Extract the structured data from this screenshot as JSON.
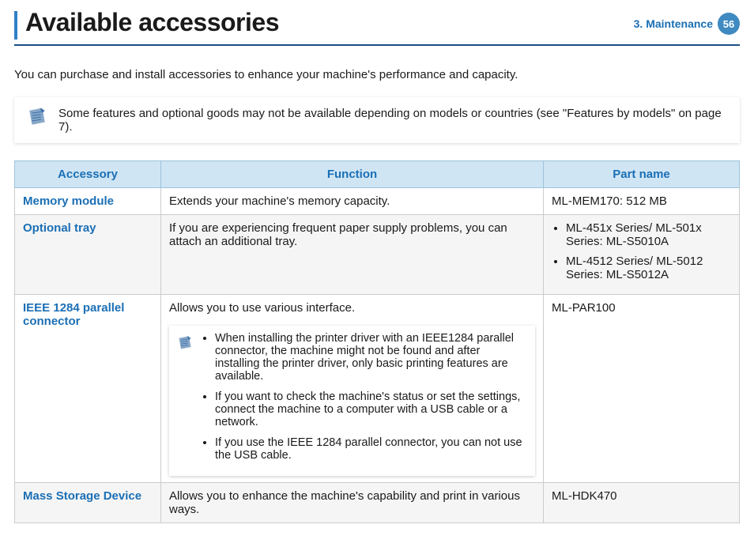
{
  "header": {
    "title": "Available accessories",
    "chapter": "3.  Maintenance",
    "page_number": "56"
  },
  "intro": "You can purchase and install accessories to enhance your machine's performance and capacity.",
  "top_note": "Some features and optional goods may not be available depending on models or countries (see \"Features by models\" on page 7).",
  "columns": {
    "c1": "Accessory",
    "c2": "Function",
    "c3": "Part name"
  },
  "rows": {
    "r1": {
      "name": "Memory module",
      "func": "Extends your machine's memory capacity.",
      "part": "ML-MEM170: 512 MB"
    },
    "r2": {
      "name": "Optional tray",
      "func": "If you are experiencing frequent paper supply problems, you can attach an additional tray.",
      "parts": {
        "p1": "ML-451x Series/  ML-501x Series: ML-S5010A",
        "p2": "ML-4512 Series/  ML-5012 Series: ML-S5012A"
      }
    },
    "r3": {
      "name": "IEEE 1284 parallel connector",
      "func": "Allows you to use various interface.",
      "notes": {
        "n1": "When installing the printer driver with an IEEE1284 parallel connector, the machine might not be found and after installing the printer driver, only basic printing features are available.",
        "n2": "If you want to check the machine's status or set the settings, connect the machine to a computer with a USB cable or a network.",
        "n3": "If you use the IEEE 1284 parallel connector, you can not use the USB cable."
      },
      "part": "ML-PAR100"
    },
    "r4": {
      "name": "Mass Storage Device",
      "func": "Allows you to enhance the machine's capability and print in various ways.",
      "part": "ML-HDK470"
    }
  }
}
